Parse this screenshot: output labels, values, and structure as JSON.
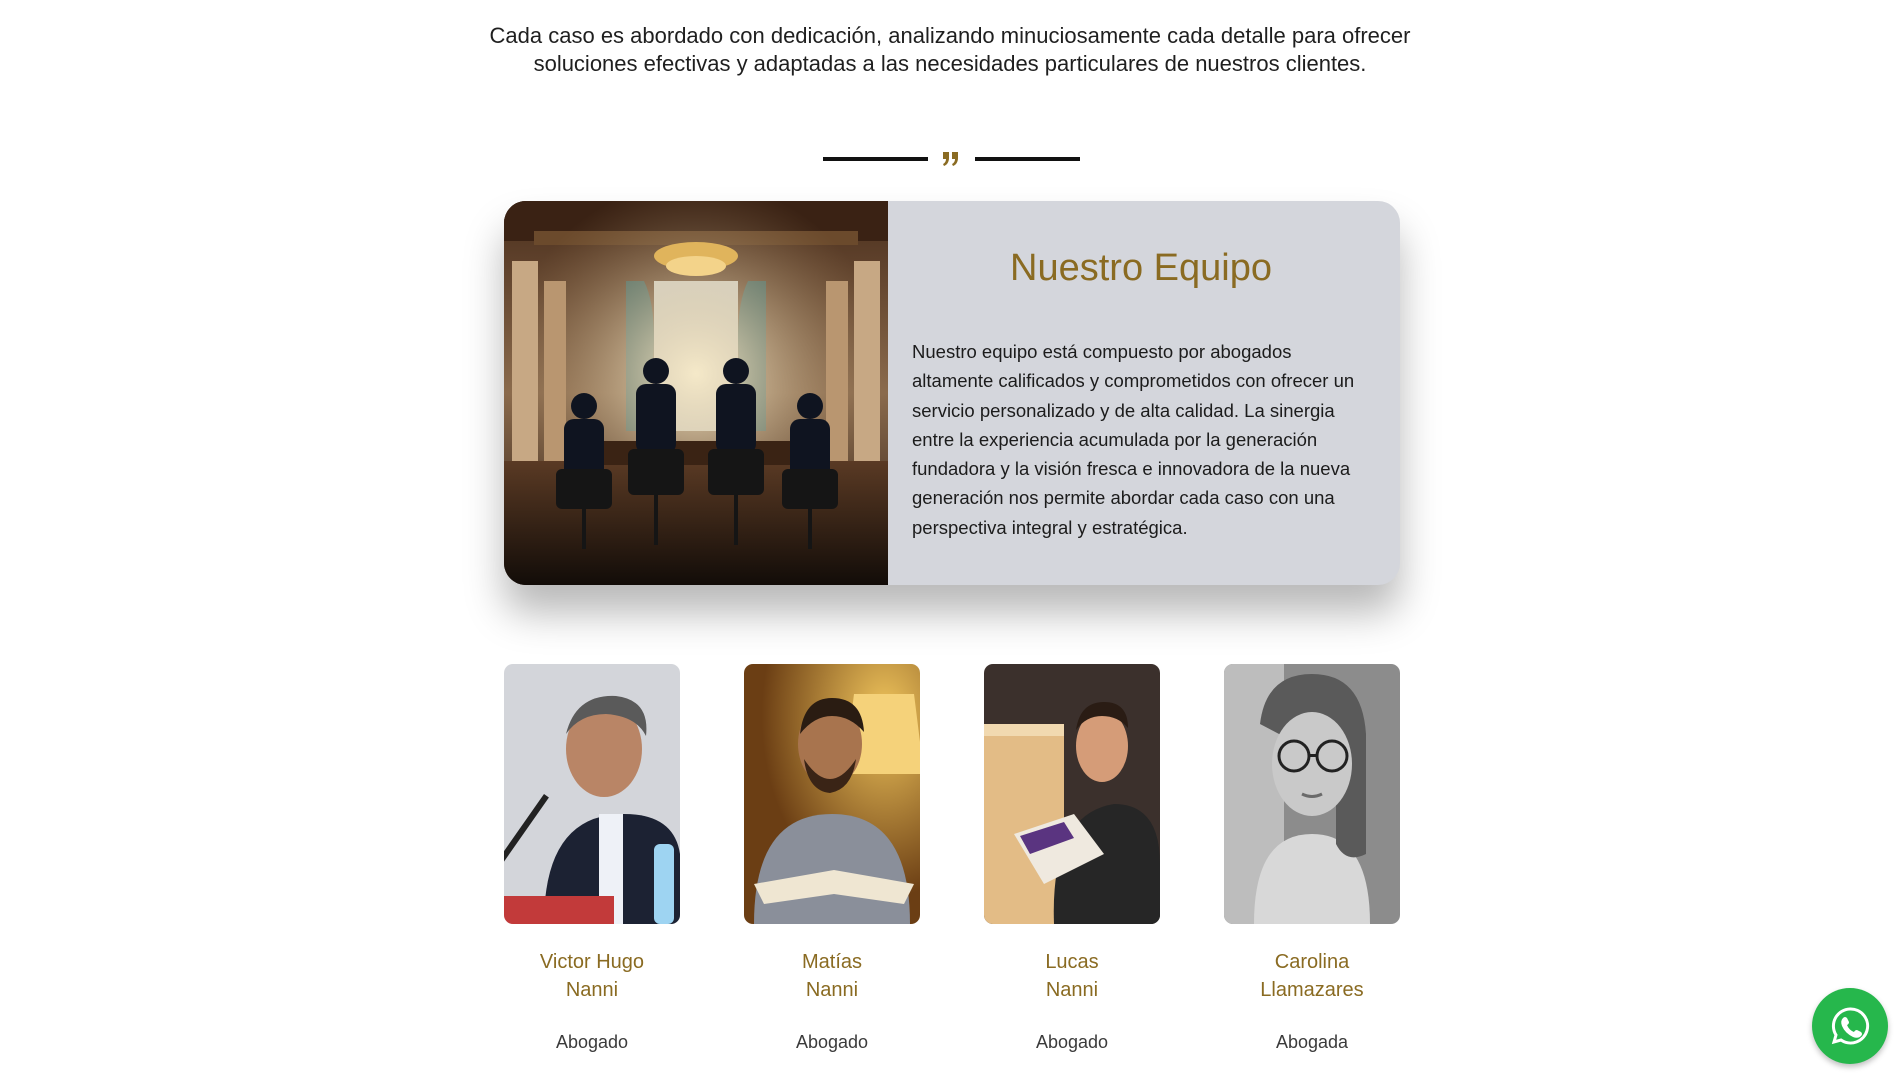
{
  "intro": {
    "line1": "Cada caso es abordado con dedicación, analizando minuciosamente cada detalle para ofrecer",
    "line2": "soluciones efectivas y adaptadas a las necesidades particulares de nuestros clientes."
  },
  "divider": {
    "icon": "quote-icon",
    "accent": "#8a6b22"
  },
  "team": {
    "title": "Nuestro Equipo",
    "body": "Nuestro equipo está compuesto por abogados altamente calificados y comprometidos con ofrecer un servicio personalizado y de alta calidad. La sinergia entre la experiencia acumulada por la generación fundadora y la visión fresca e innovadora de la nueva generación nos permite abordar cada caso con una perspectiva integral y estratégica.",
    "card_color": "#d4d6dc",
    "title_color": "#8a6b22"
  },
  "members": [
    {
      "first": "Victor Hugo",
      "last": "Nanni",
      "role": "Abogado"
    },
    {
      "first": "Matías",
      "last": "Nanni",
      "role": "Abogado"
    },
    {
      "first": "Lucas",
      "last": "Nanni",
      "role": "Abogado"
    },
    {
      "first": "Carolina",
      "last": "Llamazares",
      "role": "Abogada"
    }
  ],
  "whatsapp": {
    "icon": "whatsapp-icon",
    "color": "#26b74c"
  }
}
